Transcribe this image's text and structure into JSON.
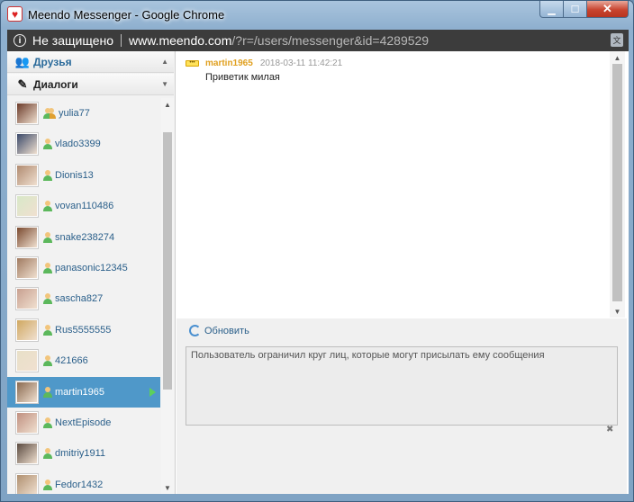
{
  "window": {
    "title": "Meendo Messenger - Google Chrome",
    "minimize": "▁",
    "maximize": "☐",
    "close": "✕"
  },
  "address_bar": {
    "security_label": "Не защищено",
    "url_host": "www.meendo.com",
    "url_rest": "/?r=/users/messenger&id=4289529"
  },
  "sidebar": {
    "friends_label": "Друзья",
    "dialogs_label": "Диалоги",
    "contacts": [
      {
        "name": "yulia77",
        "double": true
      },
      {
        "name": "vlado3399"
      },
      {
        "name": "Dionis13"
      },
      {
        "name": "vovan110486"
      },
      {
        "name": "snake238274"
      },
      {
        "name": "panasonic12345"
      },
      {
        "name": "sascha827"
      },
      {
        "name": "Rus5555555"
      },
      {
        "name": "421666"
      },
      {
        "name": "martin1965",
        "active": true
      },
      {
        "name": "NextEpisode"
      },
      {
        "name": "dmitriy1911"
      },
      {
        "name": "Fedor1432"
      }
    ]
  },
  "chat": {
    "message": {
      "author": "martin1965",
      "time": "2018-03-11 11:42:21",
      "text": "Приветик милая"
    },
    "refresh_label": "Обновить",
    "input_text": "Пользователь ограничил круг лиц, которые могут присылать ему сообщения"
  },
  "colors": {
    "active_row": "#4f98c9",
    "author": "#e0a020",
    "link": "#2a5f8a"
  }
}
